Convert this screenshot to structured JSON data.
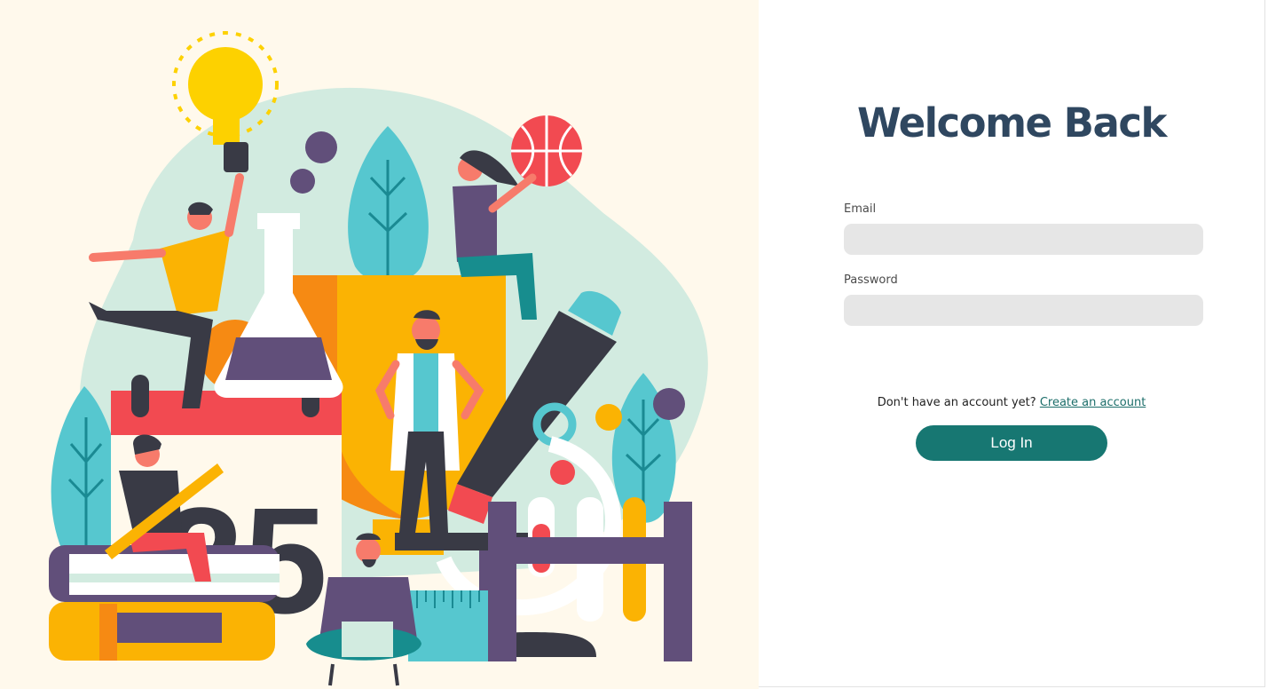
{
  "illustration": {
    "poster_number": "25"
  },
  "login_form": {
    "title": "Welcome Back",
    "email_label": "Email",
    "email_value": "",
    "email_placeholder": "",
    "password_label": "Password",
    "password_value": "",
    "password_placeholder": "",
    "signup_prompt": "Don't have an account yet?",
    "signup_link": "Create an account",
    "login_button": "Log In"
  },
  "colors": {
    "title": "#2f4760",
    "button": "#177772",
    "input_background": "#e6e6e6",
    "illustration_background": "#fff9ec"
  }
}
